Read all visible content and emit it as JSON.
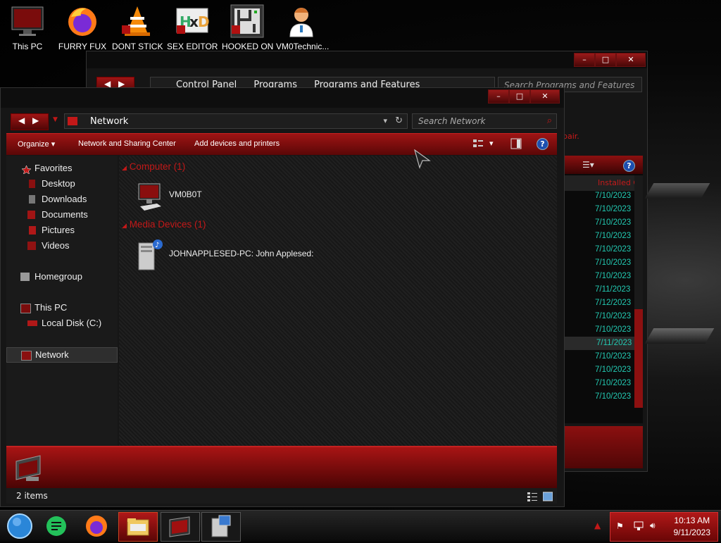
{
  "desktop": {
    "icons": [
      {
        "label": "This PC",
        "icon": "monitor-icon"
      },
      {
        "label": "FURRY FUX",
        "icon": "firefox-icon"
      },
      {
        "label": "DONT STICK",
        "icon": "vlc-cone-icon"
      },
      {
        "label": "SEX EDITOR",
        "icon": "hxd-editor-icon"
      },
      {
        "label": "HOOKED ON",
        "icon": "maze-app-icon"
      },
      {
        "label": "VM0Technic...",
        "icon": "doctor-avatar-icon"
      }
    ]
  },
  "bg_window": {
    "breadcrumb": [
      "Control Panel",
      "Programs",
      "Programs and Features"
    ],
    "search_placeholder": "Search Programs and Features",
    "red_text": "pair.",
    "column_header": "Installed O",
    "dates": [
      "7/10/2023",
      "7/10/2023",
      "7/10/2023",
      "7/10/2023",
      "7/10/2023",
      "7/10/2023",
      "7/10/2023",
      "7/11/2023",
      "7/12/2023",
      "7/10/2023",
      "7/10/2023",
      "7/11/2023",
      "7/10/2023",
      "7/10/2023",
      "7/10/2023",
      "7/10/2023"
    ],
    "selected_row_index": 11
  },
  "explorer": {
    "address": "Network",
    "search_placeholder": "Search Network",
    "commands": {
      "organize": "Organize",
      "network_sharing": "Network and Sharing Center",
      "add_devices": "Add devices and printers"
    },
    "nav": {
      "favorites": "Favorites",
      "desktop": "Desktop",
      "downloads": "Downloads",
      "documents": "Documents",
      "pictures": "Pictures",
      "videos": "Videos",
      "homegroup": "Homegroup",
      "this_pc": "This PC",
      "local_disk": "Local Disk (C:)",
      "network": "Network"
    },
    "groups": {
      "computer": {
        "title": "Computer (1)",
        "item": "VM0B0T"
      },
      "media": {
        "title": "Media Devices (1)",
        "item": "JOHNAPPLESED-PC: John Applesed:"
      }
    },
    "status": "2 items"
  },
  "taskbar": {
    "clock_time": "10:13 AM",
    "clock_date": "9/11/2023"
  },
  "colors": {
    "accent": "#b01818",
    "teal_date": "#23c9b2"
  }
}
